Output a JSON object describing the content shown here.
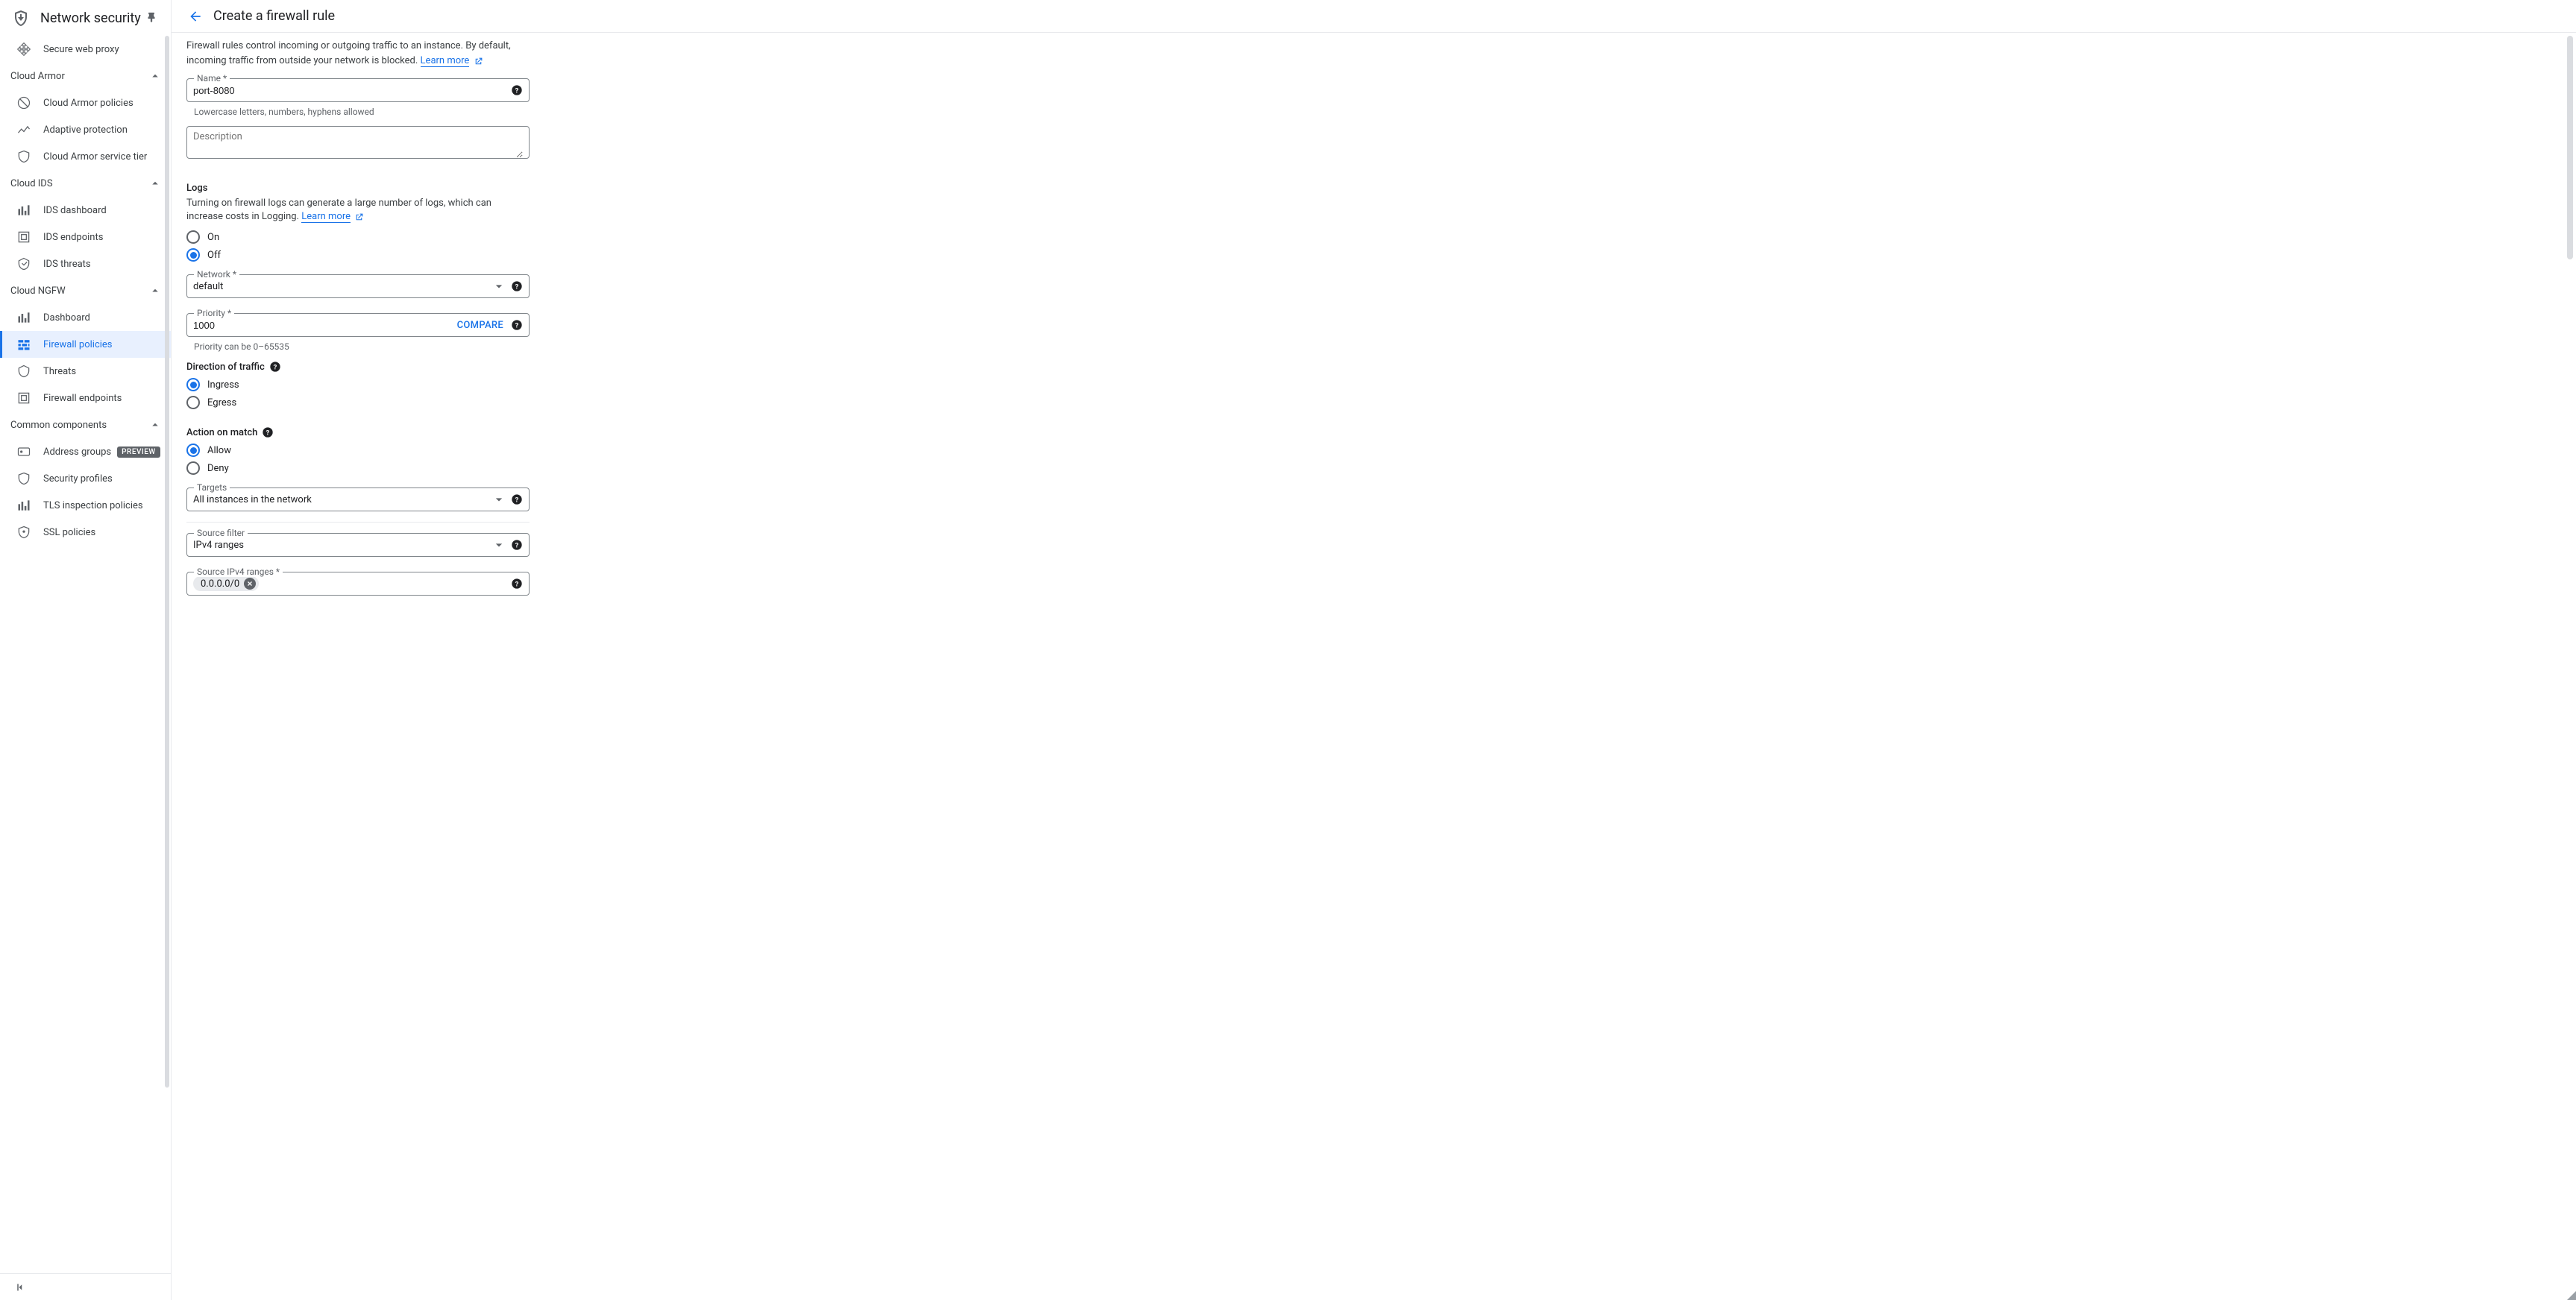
{
  "sidebar": {
    "title": "Network security",
    "top_item": "Secure web proxy",
    "groups": {
      "cloud_armor": {
        "label": "Cloud Armor",
        "items": [
          "Cloud Armor policies",
          "Adaptive protection",
          "Cloud Armor service tier"
        ]
      },
      "cloud_ids": {
        "label": "Cloud IDS",
        "items": [
          "IDS dashboard",
          "IDS endpoints",
          "IDS threats"
        ]
      },
      "cloud_ngfw": {
        "label": "Cloud NGFW",
        "items": [
          "Dashboard",
          "Firewall policies",
          "Threats",
          "Firewall endpoints"
        ]
      },
      "common": {
        "label": "Common components",
        "items": [
          "Address groups",
          "Security profiles",
          "TLS inspection policies",
          "SSL policies"
        ],
        "badge": "PREVIEW"
      }
    }
  },
  "header": {
    "title": "Create a firewall rule"
  },
  "form": {
    "intro": "Firewall rules control incoming or outgoing traffic to an instance. By default, incoming traffic from outside your network is blocked.",
    "learn_more": "Learn more",
    "name": {
      "label": "Name *",
      "value": "port-8080",
      "hint": "Lowercase letters, numbers, hyphens allowed"
    },
    "description": {
      "placeholder": "Description"
    },
    "logs": {
      "title": "Logs",
      "sub": "Turning on firewall logs can generate a large number of logs, which can increase costs in Logging.",
      "on": "On",
      "off": "Off"
    },
    "network": {
      "label": "Network *",
      "value": "default"
    },
    "priority": {
      "label": "Priority *",
      "value": "1000",
      "compare": "COMPARE",
      "hint": "Priority can be 0–65535"
    },
    "direction": {
      "title": "Direction of traffic",
      "ingress": "Ingress",
      "egress": "Egress"
    },
    "action": {
      "title": "Action on match",
      "allow": "Allow",
      "deny": "Deny"
    },
    "targets": {
      "label": "Targets",
      "value": "All instances in the network"
    },
    "source_filter": {
      "label": "Source filter",
      "value": "IPv4 ranges"
    },
    "source_ranges": {
      "label": "Source IPv4 ranges *",
      "chip": "0.0.0.0/0"
    }
  }
}
